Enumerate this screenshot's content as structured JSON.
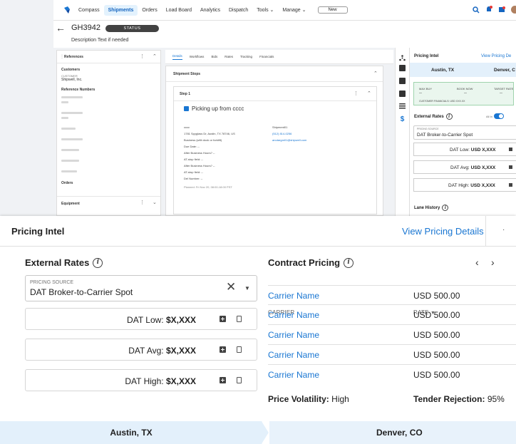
{
  "nav": {
    "items": [
      "Compass",
      "Shipments",
      "Orders",
      "Load Board",
      "Analytics",
      "Dispatch",
      "Tools",
      "Manage"
    ],
    "active": "Shipments",
    "new_label": "New"
  },
  "header": {
    "shipment_id": "GH3942",
    "status": "STATUS",
    "description": "Description Text if needed"
  },
  "tabs": [
    "Details",
    "Workflows",
    "Bids",
    "Rates",
    "Tracking",
    "Financials"
  ],
  "left_panel": {
    "references_title": "References",
    "customer_section": "Customers",
    "customer_name": "Shipwell, Inc.",
    "reference_numbers": "Reference Numbers",
    "orders": "Orders",
    "equipment": "Equipment"
  },
  "stops_panel": {
    "title": "Shipment Stops",
    "step": "Step 1",
    "picking_up": "Picking up from cccc",
    "address": "1781 Spyglass Dr, Austin, TX 78746, US",
    "contact_name": "Shipment01",
    "phone": "(512) 814-0256",
    "email": "anutargm01@shipwell.com"
  },
  "mini": {
    "title": "Pricing Intel",
    "link": "View Pricing De",
    "origin": "Austin, TX",
    "destination": "Denver, C",
    "max_buy": "MAX BUY",
    "book_now": "BOOK NOW",
    "target_rate": "TARGET RATE",
    "dash": "--",
    "customer_financials": "CUSTOMER FINANCIALS: USD XXX.XX",
    "ext_rates": "External Rates",
    "all_in": "All In",
    "src_label": "PRICING SOURCE",
    "src_value": "DAT Broker-to-Carrier Spot",
    "rates": [
      {
        "label": "DAT Low:",
        "value": "USD X,XXX"
      },
      {
        "label": "DAT Avg:",
        "value": "USD X,XXX"
      },
      {
        "label": "DAT High:",
        "value": "USD X,XXX"
      }
    ],
    "lane_history": "Lane History"
  },
  "card": {
    "title": "Pricing Intel",
    "view_link": "View Pricing Details",
    "external_rates": {
      "title": "External Rates",
      "source_label": "PRICING SOURCE",
      "source_value": "DAT Broker-to-Carrier Spot",
      "rates": [
        {
          "label": "DAT Low:",
          "value": "$X,XXX"
        },
        {
          "label": "DAT Avg:",
          "value": "$X,XXX"
        },
        {
          "label": "DAT High:",
          "value": "$X,XXX"
        }
      ]
    },
    "contract_pricing": {
      "title": "Contract Pricing",
      "col_carrier": "CARRIER",
      "col_rate": "RATE",
      "rows": [
        {
          "carrier": "Carrier Name",
          "rate": "USD 500.00"
        },
        {
          "carrier": "Carrier Name",
          "rate": "USD 500.00"
        },
        {
          "carrier": "Carrier Name",
          "rate": "USD 500.00"
        },
        {
          "carrier": "Carrier Name",
          "rate": "USD 500.00"
        },
        {
          "carrier": "Carrier Name",
          "rate": "USD 500.00"
        }
      ]
    },
    "volatility_label": "Price Volatility:",
    "volatility_value": "High",
    "tender_label": "Tender Rejection:",
    "tender_value": "95%",
    "origin": "Austin, TX",
    "destination": "Denver, CO"
  },
  "colors": {
    "accent": "#1976d2",
    "route_bg": "#e3f0fb",
    "status_bg": "#424242"
  }
}
